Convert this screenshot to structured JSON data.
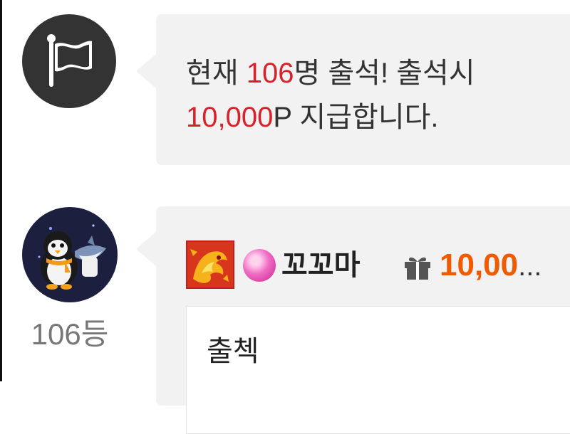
{
  "notice": {
    "prefix": "현재 ",
    "count": "106",
    "middle": "명 출석! 출석시",
    "reward": "10,000",
    "suffix": "P 지급합니다."
  },
  "post": {
    "rank": "106등",
    "nickname": "꼬꼬마",
    "points": "10,00",
    "ellipsis": "...",
    "comment": "출첵"
  },
  "icons": {
    "system": "flag-icon",
    "gift": "gift-icon",
    "badge": "dragon-badge-icon",
    "level": "candy-icon"
  },
  "colors": {
    "highlight_red": "#d8222b",
    "points_orange": "#f05a00",
    "bubble_bg": "#f2f2f2"
  }
}
